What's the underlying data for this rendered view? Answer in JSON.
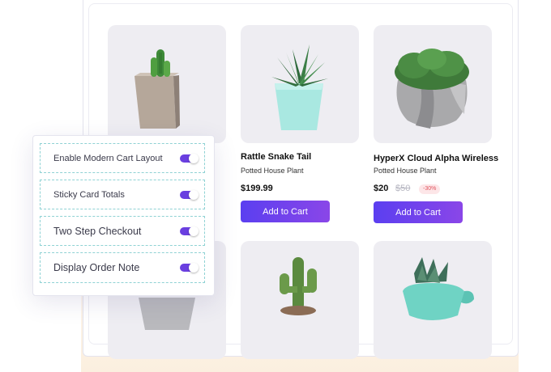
{
  "products": [
    {
      "title": "",
      "subtitle": "",
      "price": "",
      "cart_label": "",
      "image": "cactus-in-concrete-pot"
    },
    {
      "title": "Rattle Snake Tail",
      "subtitle": "Potted House Plant",
      "price": "$199.99",
      "cart_label": "Add to Cart",
      "image": "aloe-in-mint-pot"
    },
    {
      "title": "HyperX Cloud Alpha Wireless",
      "subtitle": "Potted House Plant",
      "price": "$20",
      "old_price": "$50",
      "discount": "-30%",
      "cart_label": "Add to Cart",
      "image": "moss-in-grey-pot"
    },
    {
      "title": "",
      "subtitle": "",
      "image": "plant-in-grey-pot"
    },
    {
      "title": "",
      "subtitle": "",
      "image": "cactus-in-brown-pot"
    },
    {
      "title": "",
      "subtitle": "",
      "image": "haworthia-in-mint-pot"
    }
  ],
  "settings": [
    {
      "label": "Enable Modern Cart Layout",
      "enabled": true
    },
    {
      "label": "Sticky Card Totals",
      "enabled": true
    },
    {
      "label": "Two Step Checkout",
      "enabled": true
    },
    {
      "label": "Display Order Note",
      "enabled": true
    }
  ],
  "colors": {
    "accent_start": "#5b3ff0",
    "accent_end": "#8a46e8",
    "toggle_on": "#6a3fe0",
    "row_border": "#8fd2d4",
    "discount": "#e0545e"
  }
}
